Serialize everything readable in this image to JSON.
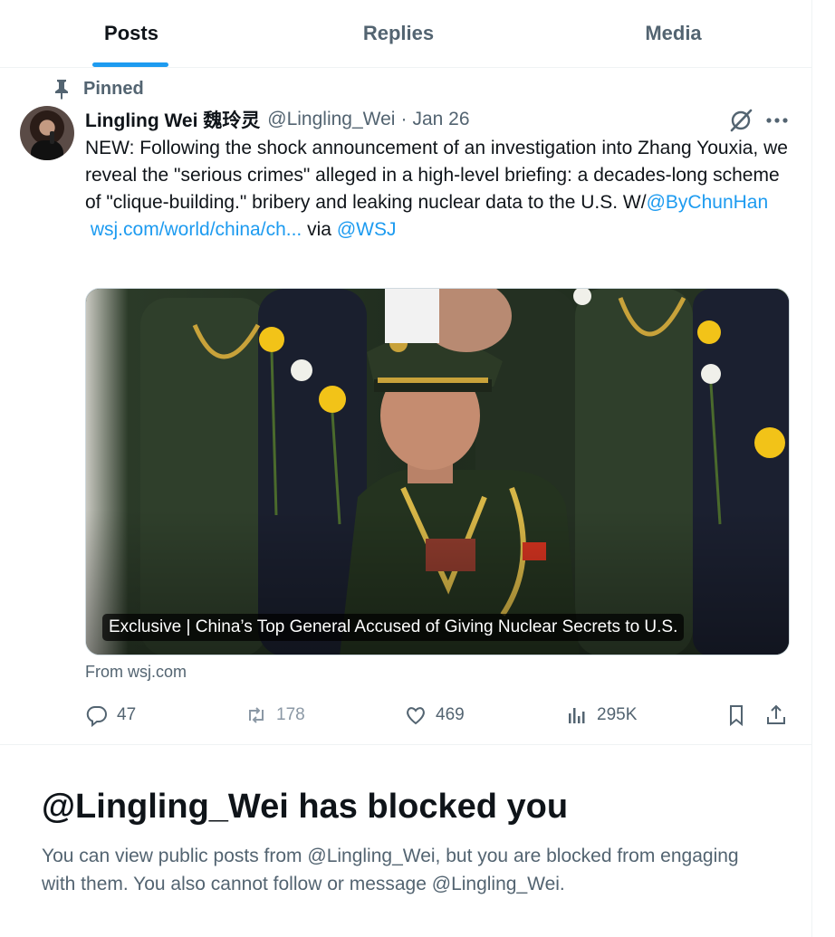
{
  "tabs": [
    {
      "label": "Posts",
      "active": true
    },
    {
      "label": "Replies",
      "active": false
    },
    {
      "label": "Media",
      "active": false
    }
  ],
  "tweet": {
    "pinned_label": "Pinned",
    "author_name": "Lingling Wei 魏玲灵",
    "handle": "@Lingling_Wei",
    "separator": "·",
    "date": "Jan 26",
    "text_main": "NEW: Following the shock announcement of an investigation into Zhang Youxia, we reveal the \"serious crimes\" alleged in a high-level briefing: a decades-long scheme of \"clique-building.\" bribery and leaking nuclear data to the U.S. W/",
    "mention_coauthor": "@ByChunHan",
    "link_text": "wsj.com/world/china/ch...",
    "via_text": "via",
    "mention_source": "@WSJ",
    "card_caption": "Exclusive | China’s Top General Accused of Giving Nuclear Secrets to U.S.",
    "card_source": "From wsj.com",
    "stats": {
      "replies": "47",
      "reposts": "178",
      "likes": "469",
      "views": "295K"
    },
    "icons": {
      "pin": "pin-icon",
      "grok": "grok-icon",
      "more": "more-icon",
      "reply": "reply-icon",
      "repost": "repost-icon",
      "like": "heart-icon",
      "views": "views-icon",
      "bookmark": "bookmark-icon",
      "share": "share-icon"
    }
  },
  "blocked": {
    "title": "@Lingling_Wei has blocked you",
    "message": "You can view public posts from @Lingling_Wei, but you are blocked from engaging with them. You also cannot follow or message @Lingling_Wei."
  },
  "colors": {
    "accent": "#1d9bf0",
    "text_primary": "#0f1419",
    "text_secondary": "#536471",
    "border": "#eff3f4"
  }
}
